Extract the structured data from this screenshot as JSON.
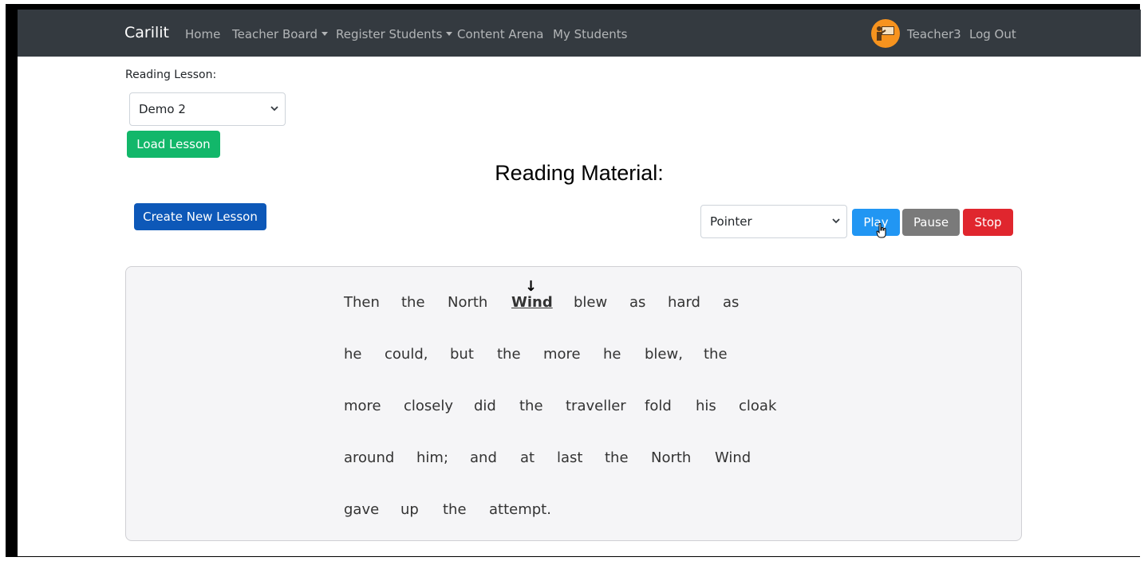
{
  "navbar": {
    "brand": "Carilit",
    "links": [
      "Home",
      "Teacher Board",
      "Register Students",
      "Content Arena",
      "My Students"
    ],
    "user": "Teacher3",
    "logout": "Log Out"
  },
  "lesson": {
    "label": "Reading Lesson:",
    "selected": "Demo 2",
    "load_button": "Load Lesson",
    "create_button": "Create New Lesson"
  },
  "reading": {
    "title": "Reading Material:",
    "mode_selected": "Pointer",
    "play": "Play",
    "pause": "Pause",
    "stop": "Stop",
    "active_word": "Wind",
    "lines": [
      [
        "Then",
        "the",
        "North",
        "Wind",
        "blew",
        "as",
        "hard",
        "as"
      ],
      [
        "he",
        "could,",
        "but",
        "the",
        "more",
        "he",
        "blew,",
        "the"
      ],
      [
        "more",
        "closely",
        "did",
        "the",
        "traveller",
        "fold",
        "his",
        "cloak"
      ],
      [
        "around",
        "him;",
        "and",
        "at",
        "last",
        "the",
        "North",
        "Wind"
      ],
      [
        "gave",
        "up",
        "the",
        "attempt."
      ]
    ],
    "pointer_glyph": "↓"
  },
  "colors": {
    "navbar": "#343a40",
    "load": "#12b76a",
    "create": "#0d58b8",
    "play": "#2196f3",
    "pause": "#7a7a7a",
    "stop": "#e0262e",
    "avatar": "#f7931e"
  }
}
